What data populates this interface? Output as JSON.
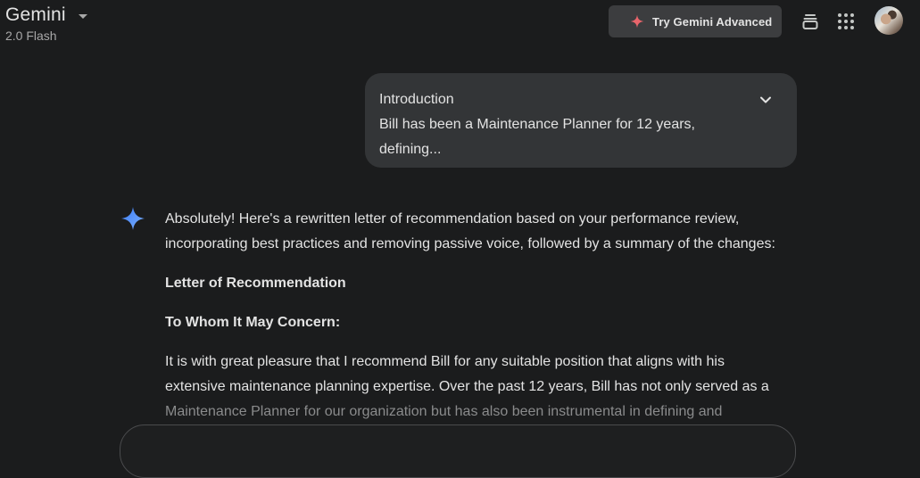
{
  "header": {
    "app_title": "Gemini",
    "model": "2.0 Flash",
    "advanced_button": "Try Gemini Advanced",
    "icons": [
      "dropdown-caret",
      "stack-icon",
      "apps-grid-icon",
      "profile-avatar"
    ]
  },
  "prompt": {
    "line1": "Introduction",
    "line2": "Bill has been a Maintenance Planner for 12 years,",
    "line3": "defining..."
  },
  "response": {
    "intro_line1": "Absolutely! Here's a rewritten letter of recommendation based on your performance review,",
    "intro_line2": "incorporating best practices and removing passive voice, followed by a summary of the changes:",
    "heading": "Letter of Recommendation",
    "salutation": "To Whom It May Concern:",
    "body_line1": "It is with great pleasure that I recommend Bill for any suitable position that aligns with his",
    "body_line2": "extensive maintenance planning expertise. Over the past 12 years, Bill has not only served as a",
    "body_line3": "Maintenance Planner for our organization but has also been instrumental in defining and"
  },
  "colors": {
    "background": "#1b1c1d",
    "bubble": "#333537",
    "button": "#3c3d3f",
    "text": "#e3e3e3",
    "muted": "#a8a8a8",
    "sparkle_blue": "#4a8cf7"
  }
}
